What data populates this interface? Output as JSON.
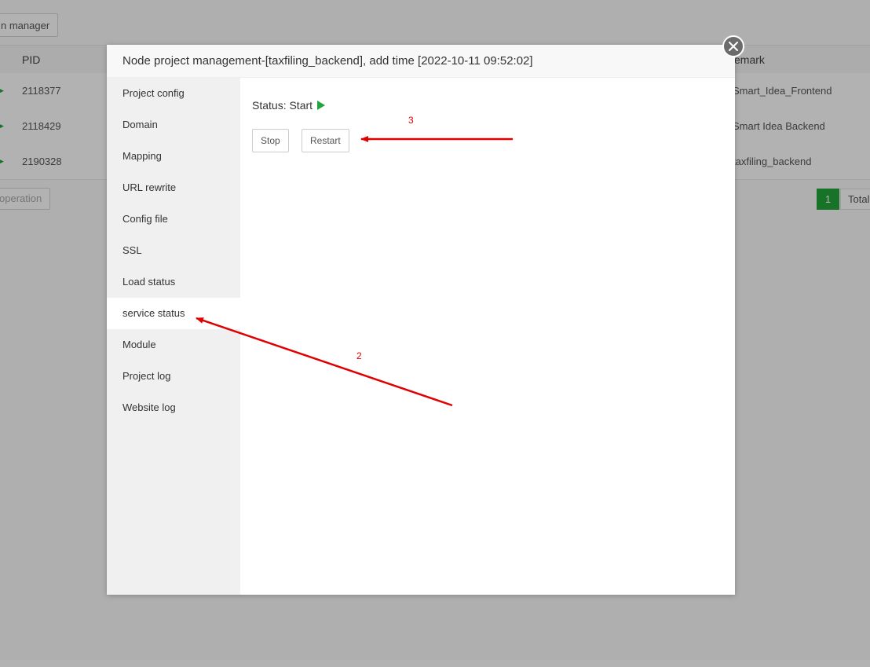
{
  "background": {
    "top_button_label": "n manager",
    "table": {
      "headers": {
        "pid": "PID",
        "remark": "emark"
      },
      "rows": [
        {
          "pid": "2118377",
          "remark": "Smart_Idea_Frontend"
        },
        {
          "pid": "2118429",
          "remark": "Smart Idea Backend"
        },
        {
          "pid": "2190328",
          "remark": "taxfiling_backend"
        }
      ]
    },
    "operation_button_label": "operation",
    "pagination": {
      "current_page": "1",
      "total_label": "Total"
    }
  },
  "dialog": {
    "title": "Node project management-[taxfiling_backend], add time [2022-10-11 09:52:02]",
    "close_icon": "close-icon",
    "sidebar": {
      "items": [
        {
          "label": "Project config"
        },
        {
          "label": "Domain"
        },
        {
          "label": "Mapping"
        },
        {
          "label": "URL rewrite"
        },
        {
          "label": "Config file"
        },
        {
          "label": "SSL"
        },
        {
          "label": "Load status"
        },
        {
          "label": "service status",
          "active": true
        },
        {
          "label": "Module"
        },
        {
          "label": "Project log"
        },
        {
          "label": "Website log"
        }
      ]
    },
    "content": {
      "status_text": "Status: Start",
      "status_icon": "play-icon",
      "status_color": "#20a53a",
      "stop_label": "Stop",
      "restart_label": "Restart"
    }
  },
  "annotations": {
    "color": "#e00000",
    "label_2": "2",
    "label_3": "3"
  }
}
